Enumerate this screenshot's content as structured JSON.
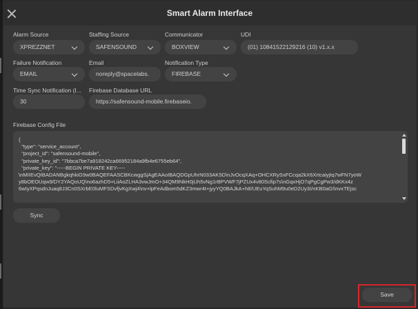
{
  "window": {
    "title": "Smart Alarm Interface"
  },
  "fields": {
    "alarm_source": {
      "label": "Alarm Source",
      "value": "XPREZZNET"
    },
    "staffing_source": {
      "label": "Staffing Source",
      "value": "SAFENSOUND"
    },
    "communicator": {
      "label": "Communicator",
      "value": "BOXVIEW"
    },
    "udi": {
      "label": "UDI",
      "value": "(01) 10841522129216 (10) v1.x.x"
    },
    "failure_notification": {
      "label": "Failure Notification",
      "value": "EMAIL"
    },
    "email": {
      "label": "Email",
      "value": "noreply@spacelabs."
    },
    "notification_type": {
      "label": "Notification Type",
      "value": "FIREBASE"
    },
    "time_sync": {
      "label": "Time Sync Notification (I...",
      "value": "30"
    },
    "firebase_url": {
      "label": "Firebase Database URL",
      "value": "https://safensound-mobile.firebaseio."
    },
    "firebase_config": {
      "label": "Firebase Config File",
      "value": "{\n  \"type\": \"service_account\",\n  \"project_id\": \"safensound-mobile\",\n  \"private_key_id\": \"7bbca7be7a918242ca66952184a9fb4e6755eb64\",\n  \"private_key\": \"-----BEGIN PRIVATE KEY-----\n\\nMIIEvQIBADANBgkqhkiG9w0BAQEFAASCBKcwggSjAgEAAoIBAQDGpUhrN033AK5D\\nJvOcqXAq+OHCXRySxFCcqa2kX6Xrtcaiyjtq7wFN7yoW\ny8bOEOUqw9/DY2YAQoUQ\\no6azhD5+LiiAoZLHA3vwJmO+34QM9NkH0jUh5vNg1rBPVWF7jPZUx4v80Scfip7s\\nGqxHjO7qPgCgPw3/dKKx4z\n6wIyXPqsdnJuaq8J3Cn0SXrbE0luMFSDvfjvKgXwj4\\nv+lpFeAdbom5dKZ3mwr4t+jyyYQ0BAJkA+h8/UEuYqSuhM9u0eD2Uy3I/nKB0aGI\\nvxTEjsc"
    }
  },
  "buttons": {
    "sync": "Sync",
    "save": "Save"
  }
}
